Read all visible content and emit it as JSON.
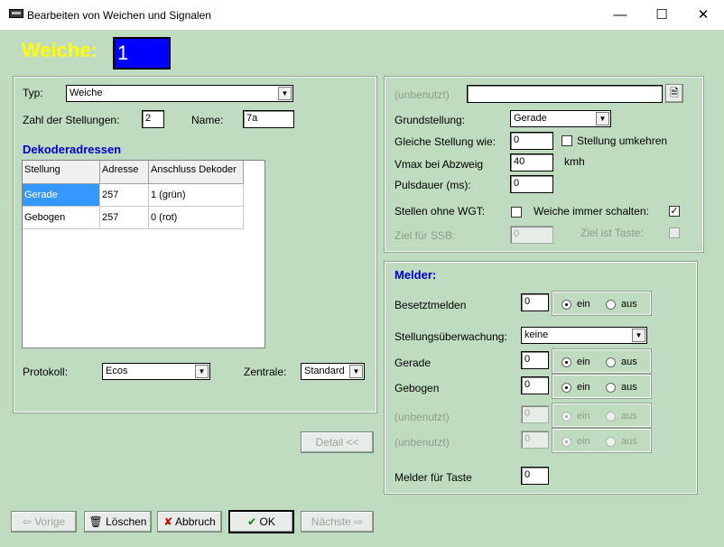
{
  "window": {
    "title": "Bearbeiten von Weichen und Signalen",
    "minimize": "—",
    "maximize": "☐",
    "close": "✕"
  },
  "header": {
    "label": "Weiche:",
    "number": "1"
  },
  "left": {
    "typ_label": "Typ:",
    "typ_value": "Weiche",
    "zahl_label": "Zahl der Stellungen:",
    "zahl_value": "2",
    "name_label": "Name:",
    "name_value": "7a",
    "dekoder_title": "Dekoderadressen",
    "table": {
      "headers": [
        "Stellung",
        "Adresse",
        "Anschluss Dekoder"
      ],
      "rows": [
        [
          "Gerade",
          "257",
          "1 (grün)"
        ],
        [
          "Gebogen",
          "257",
          "0 (rot)"
        ]
      ]
    },
    "protokoll_label": "Protokoll:",
    "protokoll_value": "Ecos",
    "zentrale_label": "Zentrale:",
    "zentrale_value": "Standard"
  },
  "detail_button": "Detail <<",
  "right": {
    "unbenutzt_label": "(unbenutzt)",
    "unbenutzt_value": "",
    "grund_label": "Grundstellung:",
    "grund_value": "Gerade",
    "gleiche_label": "Gleiche Stellung wie:",
    "gleiche_value": "0",
    "umkehren_label": "Stellung umkehren",
    "vmax_label": "Vmax bei Abzweig",
    "vmax_value": "40",
    "vmax_unit": "kmh",
    "puls_label": "Pulsdauer (ms):",
    "puls_value": "0",
    "ohne_wgt_label": "Stellen ohne WGT:",
    "immer_label": "Weiche immer schalten:",
    "immer_check": "✓",
    "ziel_ssb_label": "Ziel für SSB:",
    "ziel_ssb_value": "0",
    "ziel_taste_label": "Ziel ist Taste:"
  },
  "melder": {
    "title": "Melder:",
    "besetzt_label": "Besetztmelden",
    "besetzt_value": "0",
    "ueberw_label": "Stellungsüberwachung:",
    "ueberw_value": "keine",
    "gerade_label": "Gerade",
    "gerade_value": "0",
    "gebogen_label": "Gebogen",
    "gebogen_value": "0",
    "unb1_label": "(unbenutzt)",
    "unb1_value": "0",
    "unb2_label": "(unbenutzt)",
    "unb2_value": "0",
    "taste_label": "Melder für Taste",
    "taste_value": "0",
    "ein": "ein",
    "aus": "aus"
  },
  "buttons": {
    "vorige": "Vorige",
    "loeschen": "Löschen",
    "abbruch": "Abbruch",
    "ok": "OK",
    "naechste": "Nächste"
  }
}
